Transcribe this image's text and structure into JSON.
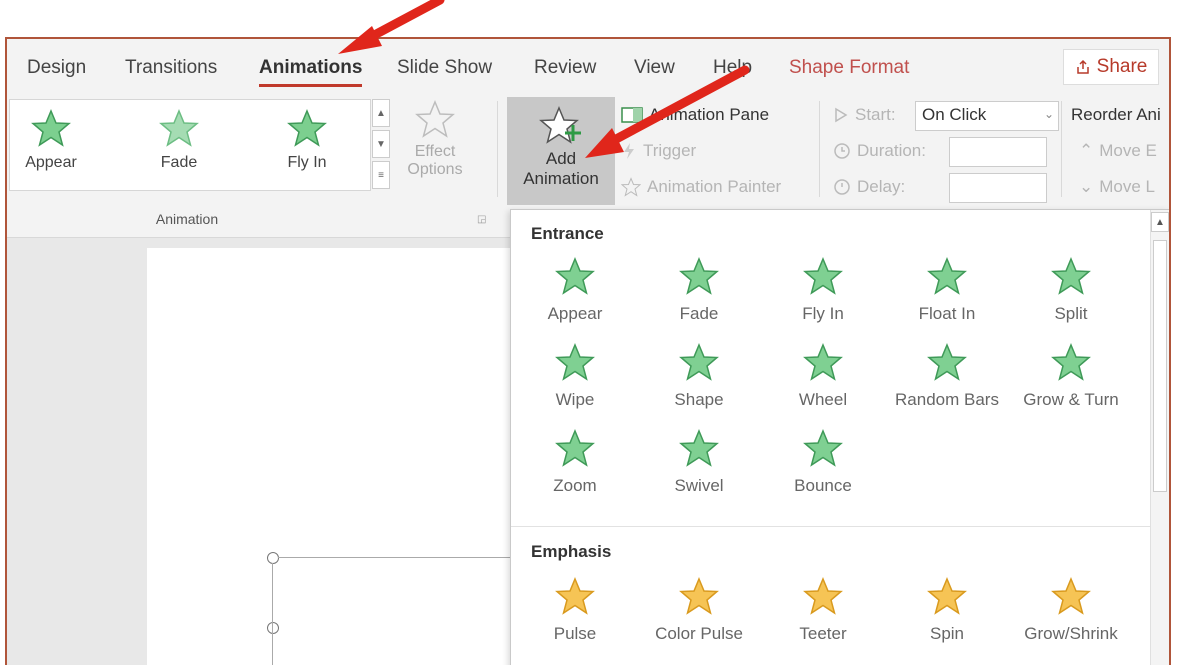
{
  "colors": {
    "accent": "#c0392b",
    "entrance_star": "#5fbf77",
    "emphasis_star": "#f3b73c",
    "arrow": "#e0261b"
  },
  "tabs": [
    {
      "label": "Design"
    },
    {
      "label": "Transitions"
    },
    {
      "label": "Animations",
      "active": true
    },
    {
      "label": "Slide Show"
    },
    {
      "label": "Review"
    },
    {
      "label": "View"
    },
    {
      "label": "Help"
    },
    {
      "label": "Shape Format"
    }
  ],
  "share_label": "Share",
  "gallery": [
    {
      "label": "Appear",
      "icon": "appear-star-icon"
    },
    {
      "label": "Fade",
      "icon": "fade-star-icon"
    },
    {
      "label": "Fly In",
      "icon": "fly-in-star-icon"
    }
  ],
  "effect_options": {
    "line1": "Effect",
    "line2": "Options"
  },
  "group_label": "Animation",
  "add_animation": {
    "line1": "Add",
    "line2": "Animation"
  },
  "advanced": {
    "animation_pane": "Animation Pane",
    "trigger": "Trigger",
    "animation_painter": "Animation Painter"
  },
  "timing": {
    "start_label": "Start:",
    "start_value": "On Click",
    "duration_label": "Duration:",
    "delay_label": "Delay:"
  },
  "reorder": {
    "title": "Reorder Ani",
    "move_earlier": "Move E",
    "move_later": "Move L"
  },
  "dropdown": {
    "entrance_title": "Entrance",
    "entrance": [
      {
        "label": "Appear"
      },
      {
        "label": "Fade"
      },
      {
        "label": "Fly In"
      },
      {
        "label": "Float In"
      },
      {
        "label": "Split"
      },
      {
        "label": "Wipe"
      },
      {
        "label": "Shape"
      },
      {
        "label": "Wheel"
      },
      {
        "label": "Random Bars"
      },
      {
        "label": "Grow & Turn"
      },
      {
        "label": "Zoom"
      },
      {
        "label": "Swivel"
      },
      {
        "label": "Bounce"
      }
    ],
    "emphasis_title": "Emphasis",
    "emphasis": [
      {
        "label": "Pulse"
      },
      {
        "label": "Color Pulse"
      },
      {
        "label": "Teeter"
      },
      {
        "label": "Spin"
      },
      {
        "label": "Grow/Shrink"
      }
    ]
  }
}
